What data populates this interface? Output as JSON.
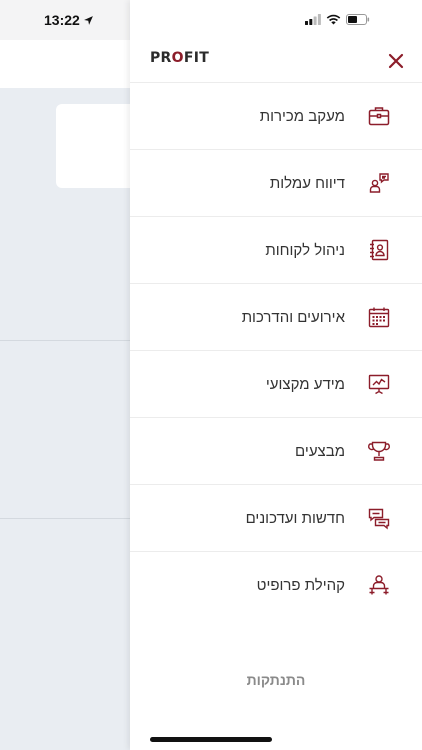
{
  "status_bar": {
    "time": "13:22"
  },
  "drawer": {
    "logo": {
      "left": "PR",
      "o": "O",
      "right": "FIT"
    },
    "close_icon": "close-icon",
    "menu": [
      {
        "label": "מעקב מכירות",
        "icon": "briefcase-icon"
      },
      {
        "label": "דיווח עמלות",
        "icon": "commission-report-icon"
      },
      {
        "label": "ניהול לקוחות",
        "icon": "contacts-book-icon"
      },
      {
        "label": "אירועים והדרכות",
        "icon": "calendar-icon"
      },
      {
        "label": "מידע מקצועי",
        "icon": "presentation-chart-icon"
      },
      {
        "label": "מבצעים",
        "icon": "trophy-icon"
      },
      {
        "label": "חדשות ועדכונים",
        "icon": "news-chat-icon"
      },
      {
        "label": "קהילת פרופיט",
        "icon": "community-icon"
      }
    ],
    "logout_label": "התנתקות"
  },
  "colors": {
    "accent": "#8c1d2a",
    "divider": "#ececec",
    "text": "#333333",
    "muted": "#8a8a8a"
  }
}
